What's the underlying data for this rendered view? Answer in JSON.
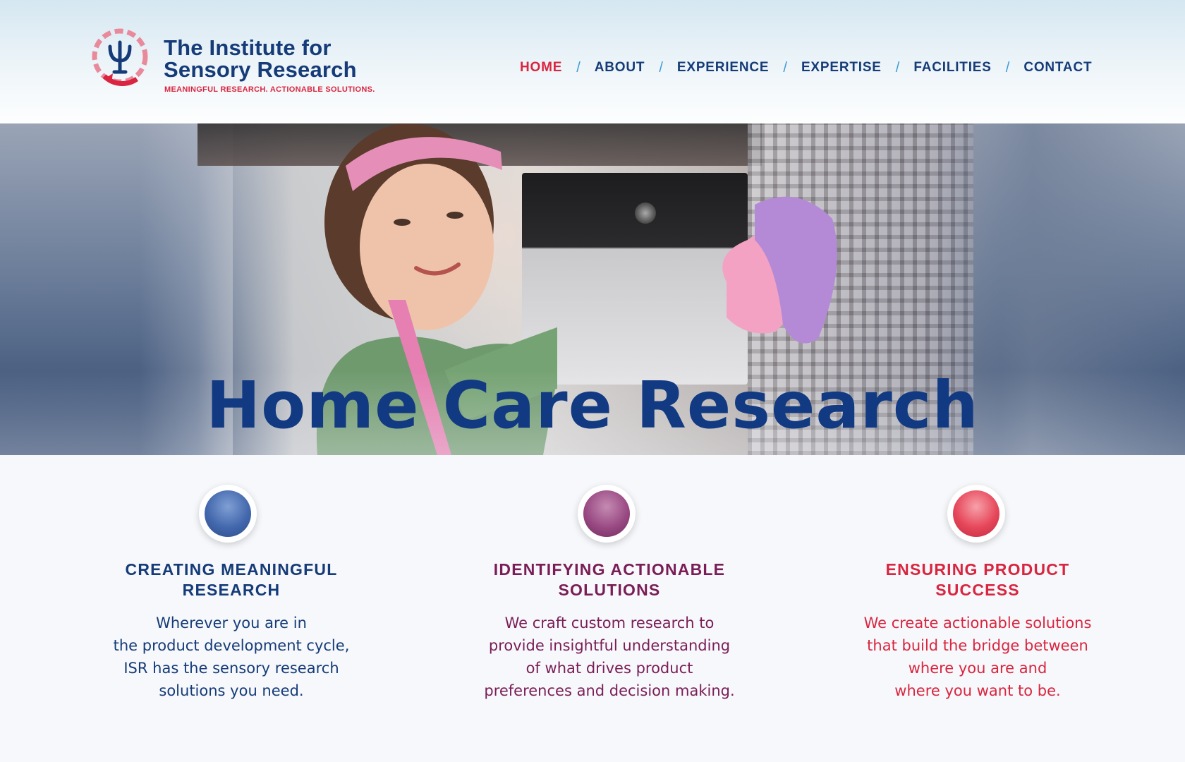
{
  "brand": {
    "name_line1": "The Institute for",
    "name_line2": "Sensory Research",
    "tagline": "MEANINGFUL RESEARCH. ACTIONABLE SOLUTIONS.",
    "colors": {
      "navy": "#153b78",
      "red": "#d9253f",
      "plum": "#7a1d56",
      "sky": "#3b9ad8"
    }
  },
  "nav": {
    "separator": "/",
    "items": [
      {
        "label": "HOME",
        "active": true
      },
      {
        "label": "ABOUT"
      },
      {
        "label": "EXPERIENCE"
      },
      {
        "label": "EXPERTISE"
      },
      {
        "label": "FACILITIES"
      },
      {
        "label": "CONTACT"
      }
    ]
  },
  "hero": {
    "title": "Home Care Research"
  },
  "features": [
    {
      "title_lines": [
        "CREATING MEANINGFUL",
        "RESEARCH"
      ],
      "body_lines": [
        "Wherever you are in",
        "the product development cycle,",
        "ISR has the sensory research",
        "solutions you need."
      ],
      "orb_color": "#3d64a8",
      "icon": "blue-orb-icon"
    },
    {
      "title_lines": [
        "IDENTIFYING ACTIONABLE",
        "SOLUTIONS"
      ],
      "body_lines": [
        "We craft custom research to",
        "provide insightful understanding",
        "of what drives product",
        "preferences and decision making."
      ],
      "orb_color": "#8e3a72",
      "icon": "plum-orb-icon"
    },
    {
      "title_lines": [
        "ENSURING PRODUCT",
        "SUCCESS"
      ],
      "body_lines": [
        "We create actionable solutions",
        "that build the bridge between",
        "where you are and",
        "where you want to be."
      ],
      "orb_color": "#e2404f",
      "icon": "red-orb-icon"
    }
  ]
}
